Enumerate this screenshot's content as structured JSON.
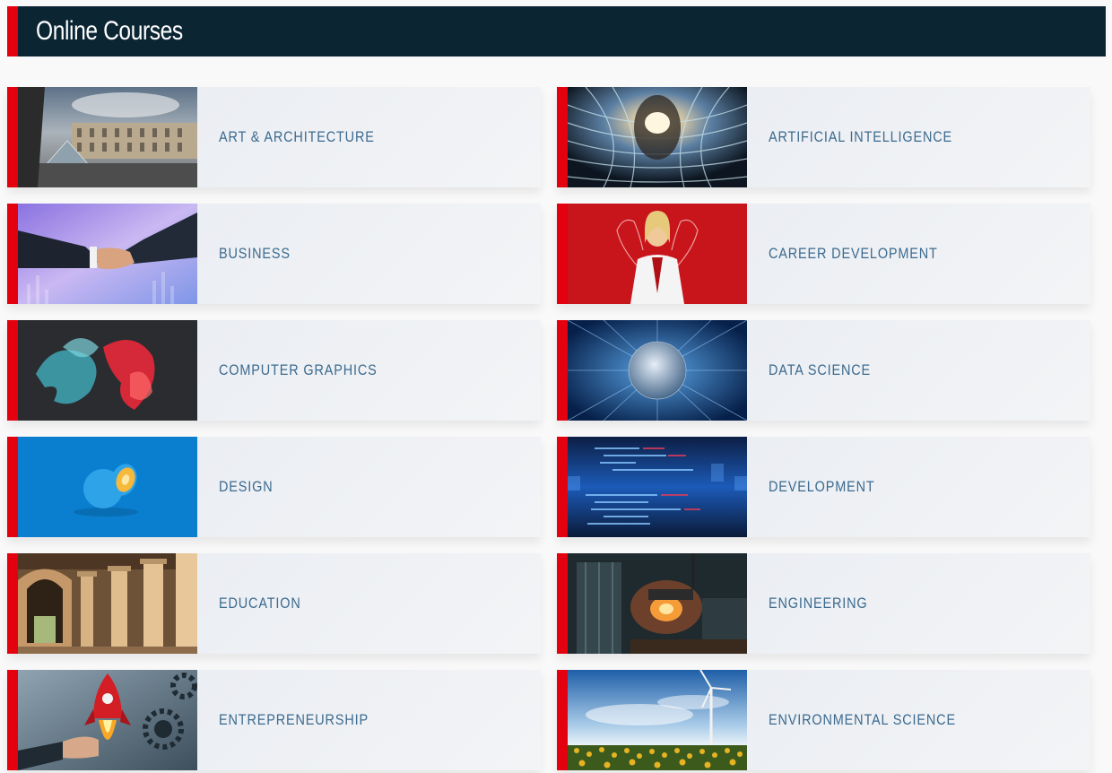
{
  "header": {
    "title": "Online Courses"
  },
  "courses": [
    {
      "label": "ART & ARCHITECTURE",
      "icon": "louvre-photo"
    },
    {
      "label": "ARTIFICIAL INTELLIGENCE",
      "icon": "ai-face-photo"
    },
    {
      "label": "BUSINESS",
      "icon": "handshake-photo"
    },
    {
      "label": "CAREER DEVELOPMENT",
      "icon": "strong-woman-photo"
    },
    {
      "label": "COMPUTER GRAPHICS",
      "icon": "smoke-photo"
    },
    {
      "label": "DATA SCIENCE",
      "icon": "globe-network-photo"
    },
    {
      "label": "DESIGN",
      "icon": "orange-photo"
    },
    {
      "label": "DEVELOPMENT",
      "icon": "code-screens-photo"
    },
    {
      "label": "EDUCATION",
      "icon": "arcade-photo"
    },
    {
      "label": "ENGINEERING",
      "icon": "factory-photo"
    },
    {
      "label": "ENTREPRENEURSHIP",
      "icon": "rocket-gears-photo"
    },
    {
      "label": "ENVIRONMENTAL SCIENCE",
      "icon": "wind-turbine-photo"
    }
  ],
  "colors": {
    "accent": "#e3000f",
    "header_bg": "#0b2533",
    "label": "#3b6a8f"
  }
}
